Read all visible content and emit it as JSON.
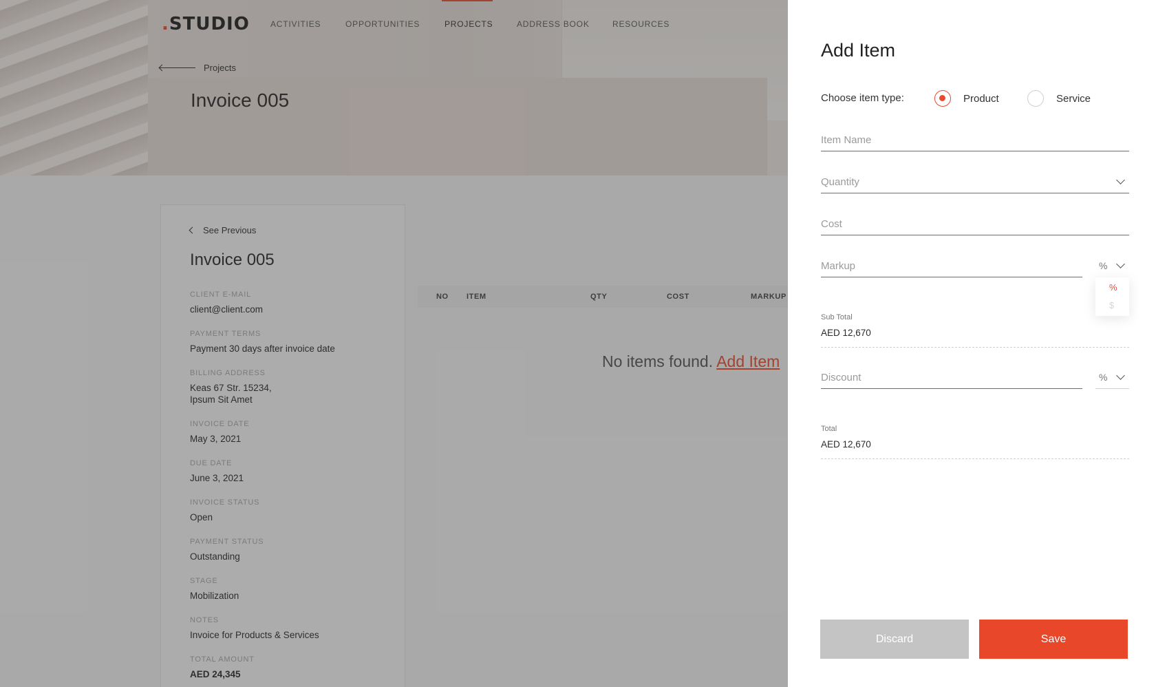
{
  "brand": {
    "logo": "STUDIO",
    "logo_dot": "."
  },
  "nav": {
    "items": [
      "ACTIVITIES",
      "OPPORTUNITIES",
      "PROJECTS",
      "ADDRESS BOOK",
      "RESOURCES"
    ],
    "active": "PROJECTS"
  },
  "breadcrumb": {
    "back_label": "Projects"
  },
  "hero": {
    "title": "Invoice 005"
  },
  "invoice_card": {
    "see_previous": "See Previous",
    "title": "Invoice 005",
    "fields": [
      {
        "label": "CLIENT E-MAIL",
        "value": "client@client.com"
      },
      {
        "label": "PAYMENT TERMS",
        "value": "Payment 30 days after invoice date"
      },
      {
        "label": "BILLING ADDRESS",
        "value": "Keas 67 Str. 15234,",
        "value2": "Ipsum Sit Amet"
      },
      {
        "label": "INVOICE DATE",
        "value": "May 3, 2021"
      },
      {
        "label": "DUE DATE",
        "value": "June 3, 2021"
      },
      {
        "label": "INVOICE STATUS",
        "value": "Open"
      },
      {
        "label": "PAYMENT STATUS",
        "value": "Outstanding"
      },
      {
        "label": "STAGE",
        "value": "Mobilization"
      },
      {
        "label": "NOTES",
        "value": "Invoice for Products & Services"
      },
      {
        "label": "TOTAL AMOUNT",
        "value": "AED 24,345"
      }
    ]
  },
  "items_table": {
    "columns": [
      "NO",
      "ITEM",
      "QTY",
      "COST",
      "MARKUP"
    ],
    "empty_text": "No items found.",
    "add_link": "Add Item"
  },
  "drawer": {
    "title": "Add Item",
    "type_label": "Choose item type:",
    "types": [
      {
        "label": "Product",
        "checked": true
      },
      {
        "label": "Service",
        "checked": false
      }
    ],
    "fields": {
      "item_name": {
        "placeholder": "Item Name",
        "value": ""
      },
      "quantity": {
        "placeholder": "Quantity",
        "value": ""
      },
      "cost": {
        "placeholder": "Cost",
        "value": ""
      },
      "markup": {
        "placeholder": "Markup",
        "value": "",
        "unit": "%"
      },
      "discount": {
        "placeholder": "Discount",
        "value": "",
        "unit": "%"
      }
    },
    "unit_options": [
      "%",
      "$"
    ],
    "subtotal": {
      "label": "Sub Total",
      "value": "AED 12,670"
    },
    "total": {
      "label": "Total",
      "value": "AED 12,670"
    },
    "buttons": {
      "discard": "Discard",
      "save": "Save"
    }
  },
  "colors": {
    "accent": "#e74c2e",
    "discard_bg": "#c4c4c4",
    "overlay": "rgba(50,50,50,0.38)"
  }
}
